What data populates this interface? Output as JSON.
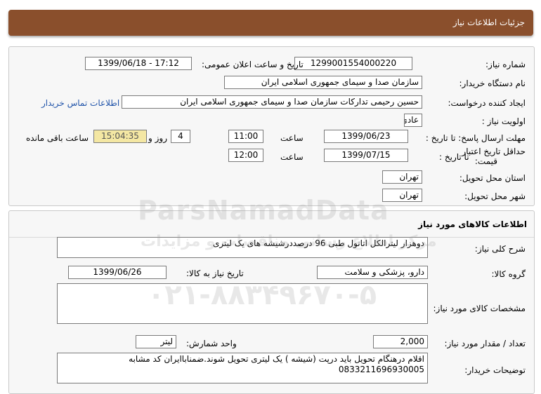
{
  "header": {
    "title": "جزئیات اطلاعات نیاز"
  },
  "info": {
    "need_number_label": "شماره نیاز:",
    "need_number": "1299001554000220",
    "announce_label": "تاریخ و ساعت اعلان عمومی:",
    "announce_value": "1399/06/18 - 17:12",
    "buyer_org_label": "نام دستگاه خریدار:",
    "buyer_org": "سازمان صدا و سیمای جمهوری اسلامی ایران",
    "requester_label": "ایجاد کننده درخواست:",
    "requester": "حسین رحیمی تدارکات سازمان صدا و سیمای جمهوری اسلامی ایران",
    "contact_link": "اطلاعات تماس خریدار",
    "priority_label": "اولویت نیاز :",
    "priority": "عادی",
    "reply_deadline_label": "مهلت ارسال پاسخ: تا تاریخ :",
    "reply_date": "1399/06/23",
    "time_label": "ساعت",
    "reply_time": "11:00",
    "days": "4",
    "days_and_label": "روز و",
    "remaining_time": "15:04:35",
    "remaining_label": "ساعت باقی مانده",
    "price_validity_label_1": "حداقل تاریخ اعتبار",
    "price_validity_label_2": "قیمت:",
    "until_date_label": "تا تاریخ :",
    "validity_date": "1399/07/15",
    "validity_time": "12:00",
    "province_label": "استان محل تحویل:",
    "province": "تهران",
    "city_label": "شهر محل تحویل:",
    "city": "تهران"
  },
  "goods": {
    "section_title": "اطلاعات کالاهای مورد نیاز",
    "general_desc_label": "شرح کلی نیاز:",
    "general_desc": "دوهزار لیترالکل اتانول طبی 96 درصددرشیشه های یک لیتری",
    "group_label": "گروه کالا:",
    "group": "دارو، پزشکی و سلامت",
    "need_date_label": "تاریخ نیاز به کالا:",
    "need_date": "1399/06/26",
    "specs_label": "مشخصات کالای مورد نیاز:",
    "specs": "",
    "qty_label": "تعداد / مقدار مورد نیاز:",
    "qty": "2,000",
    "unit_label": "واحد شمارش:",
    "unit": "لیتر",
    "buyer_notes_label": "توضیحات خریدار:",
    "buyer_notes": "اقلام درهنگام تحویل باید درپت (شیشه ) یک لیتری تحویل شوند.ضمناباایران کد مشابه 0833211696930005"
  },
  "watermark": {
    "brand": "ParsNamadData",
    "tagline": "مرکز اطلاع رسانی مناقصات و مزایدات",
    "phone": "۰۲۱-۸۸۳۴۹۶۷۰-۵"
  },
  "colors": {
    "titlebar": "#8a4f2c",
    "remaining_bg": "#f4e7a3",
    "link": "#2255aa"
  }
}
